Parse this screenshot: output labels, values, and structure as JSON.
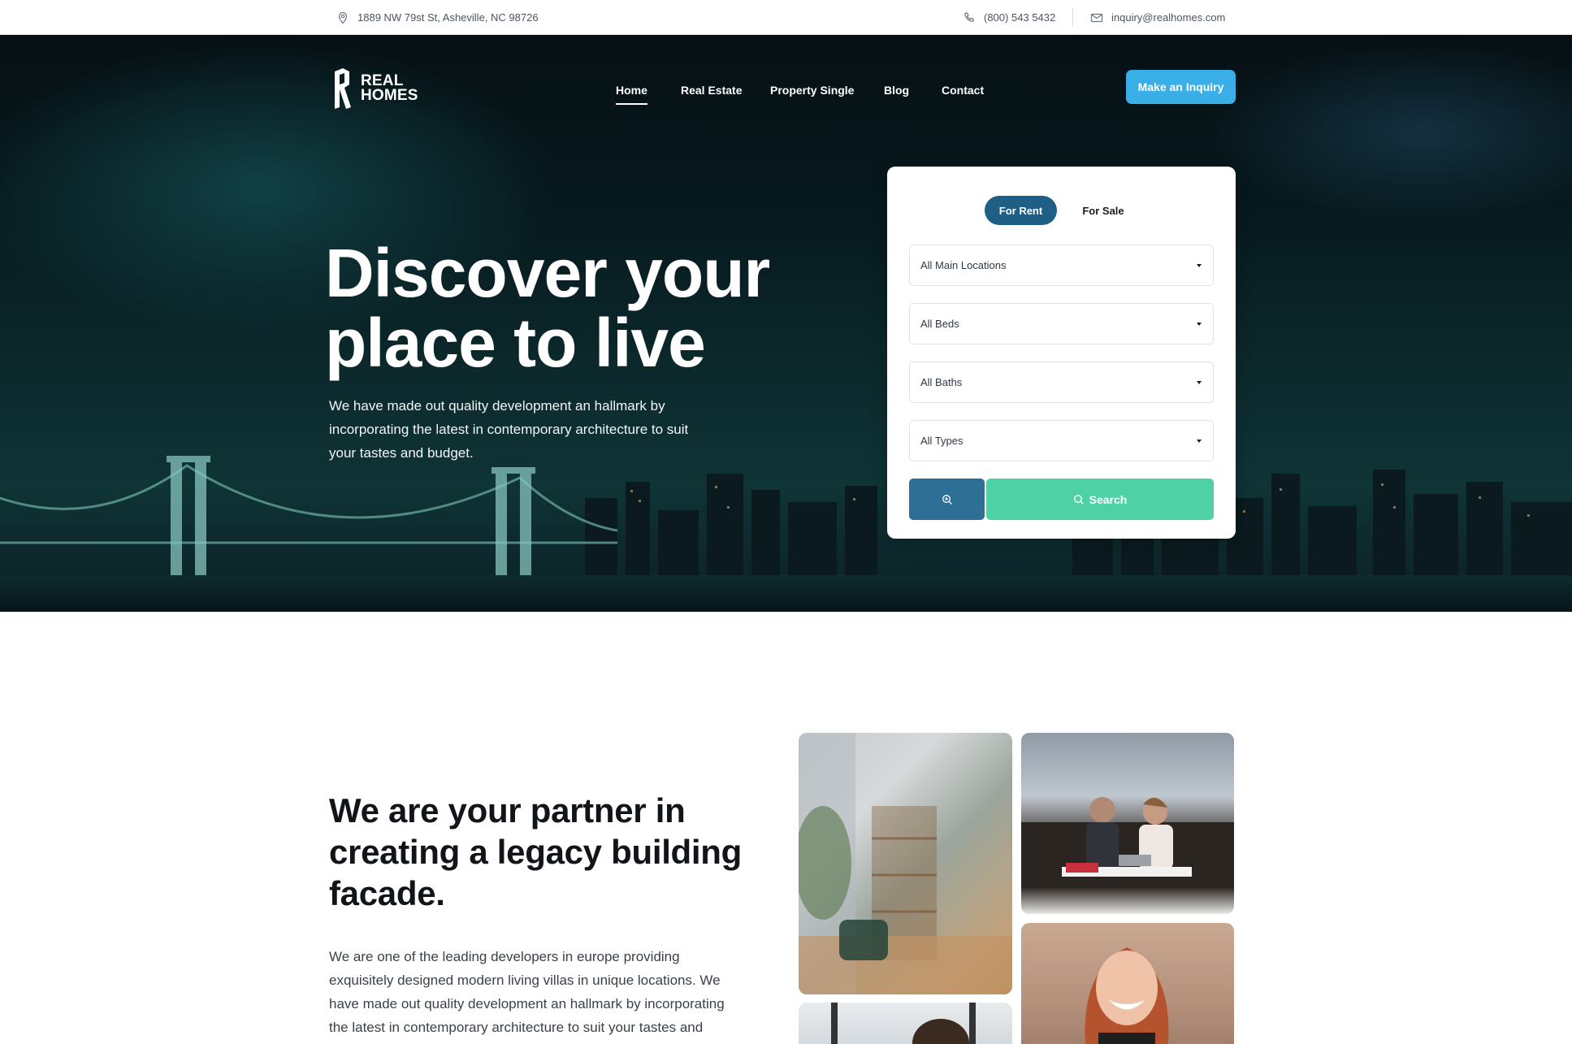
{
  "topbar": {
    "address": "1889 NW 79st St, Asheville, NC 98726",
    "phone": "(800) 543 5432",
    "email": "inquiry@realhomes.com",
    "icons": [
      "map-pin-icon",
      "phone-icon",
      "mail-icon"
    ]
  },
  "header": {
    "logo_line1": "REAL",
    "logo_line2": "HOMES",
    "nav": [
      {
        "label": "Home",
        "active": true
      },
      {
        "label": "Real Estate"
      },
      {
        "label": "Property Single"
      },
      {
        "label": "Blog"
      },
      {
        "label": "Contact"
      }
    ],
    "cta_label": "Make an Inquiry"
  },
  "hero": {
    "title_line1": "Discover your",
    "title_line2": "place to live",
    "lead": "We have made out quality development an hallmark by incorporating the latest in contemporary architecture to suit your tastes and budget."
  },
  "search": {
    "tabs": [
      {
        "label": "For Rent",
        "active": true
      },
      {
        "label": "For Sale",
        "active": false
      }
    ],
    "selects": [
      {
        "value": "All Main Locations"
      },
      {
        "value": "All Beds"
      },
      {
        "value": "All Baths"
      },
      {
        "value": "All Types"
      }
    ],
    "search_label": "Search"
  },
  "about": {
    "heading": "We are your partner in creating a legacy building facade.",
    "body": "We are one of the leading developers in europe providing exquisitely designed modern living villas in unique locations. We have made out quality development an hallmark by incorporating the latest in contemporary architecture to suit your tastes and"
  },
  "colors": {
    "accent_blue": "#3aaee7",
    "tab_active": "#1f5f86",
    "adv_button": "#2e6f96",
    "search_button": "#4fd1a6"
  }
}
